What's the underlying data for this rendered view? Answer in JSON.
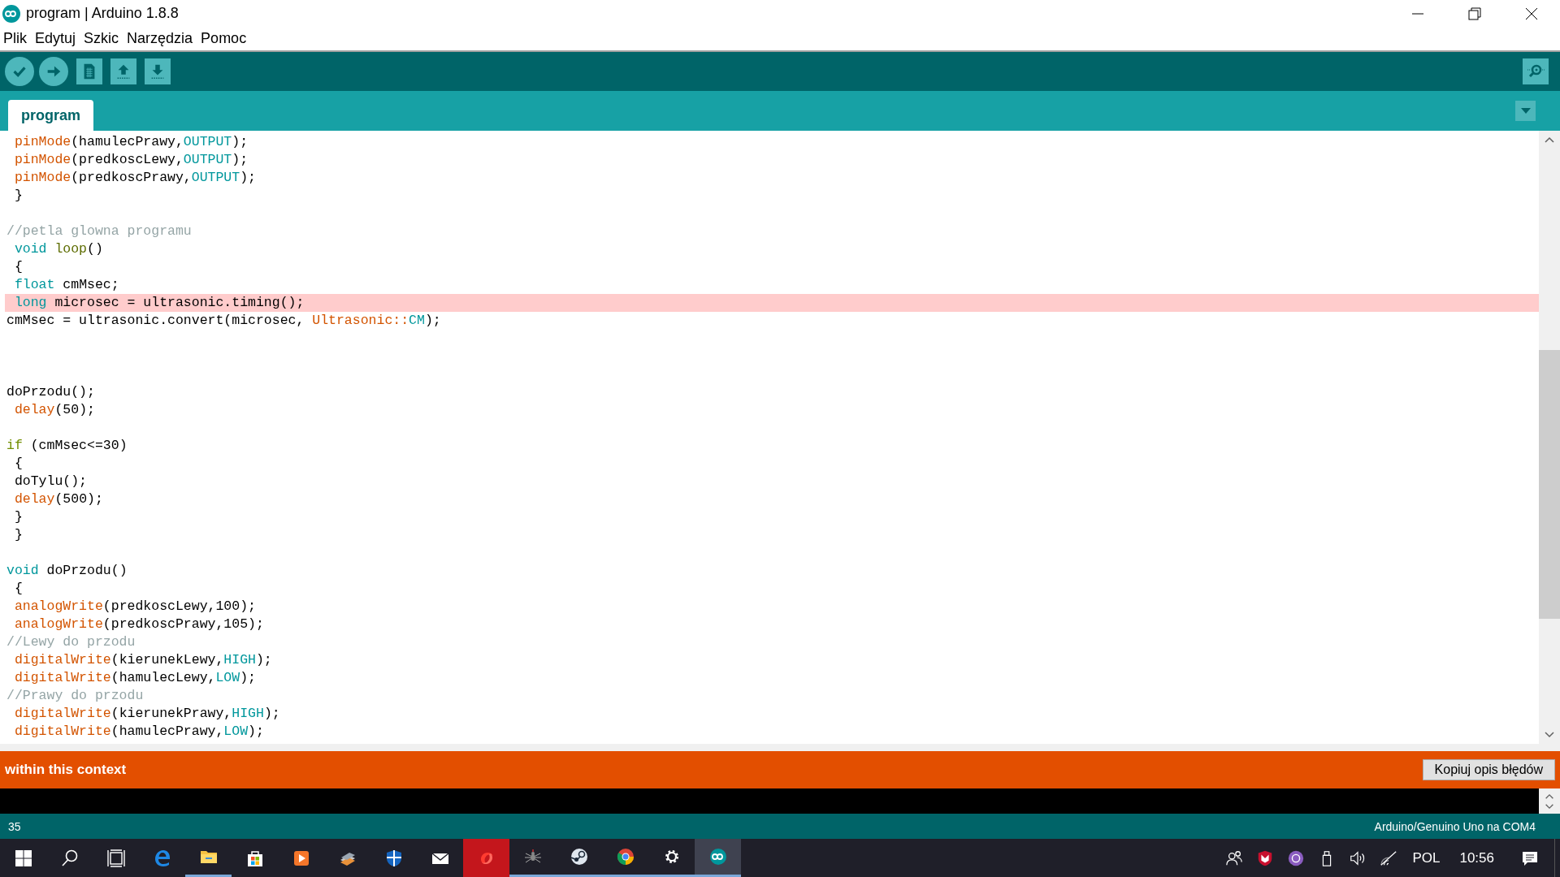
{
  "window": {
    "title": "program | Arduino 1.8.8"
  },
  "menu": [
    "Plik",
    "Edytuj",
    "Szkic",
    "Narzędzia",
    "Pomoc"
  ],
  "toolbar": {
    "buttons": [
      {
        "kind": "verify"
      },
      {
        "kind": "upload"
      },
      {
        "kind": "new"
      },
      {
        "kind": "open"
      },
      {
        "kind": "save"
      }
    ]
  },
  "tabs": [
    {
      "label": "program",
      "selected": true
    }
  ],
  "editor": {
    "lines": [
      {
        "highlighted": false,
        "tokens": [
          {
            "t": " pinMode",
            "kind": "fn"
          },
          {
            "t": "(hamulecPrawy,",
            "kind": "p"
          },
          {
            "t": "OUTPUT",
            "kind": "const"
          },
          {
            "t": ");",
            "kind": "p"
          }
        ]
      },
      {
        "highlighted": false,
        "tokens": [
          {
            "t": " pinMode",
            "kind": "fn"
          },
          {
            "t": "(predkoscLewy,",
            "kind": "p"
          },
          {
            "t": "OUTPUT",
            "kind": "const"
          },
          {
            "t": ");",
            "kind": "p"
          }
        ]
      },
      {
        "highlighted": false,
        "tokens": [
          {
            "t": " pinMode",
            "kind": "fn"
          },
          {
            "t": "(predkoscPrawy,",
            "kind": "p"
          },
          {
            "t": "OUTPUT",
            "kind": "const"
          },
          {
            "t": ");",
            "kind": "p"
          }
        ]
      },
      {
        "highlighted": false,
        "tokens": [
          {
            "t": " }",
            "kind": "p"
          }
        ]
      },
      {
        "highlighted": false
      },
      {
        "highlighted": false,
        "tokens": [
          {
            "t": "//petla glowna programu",
            "kind": "cm"
          }
        ]
      },
      {
        "highlighted": false,
        "tokens": [
          {
            "t": " void",
            "kind": "kw"
          },
          {
            "t": " loop",
            "kind": "lp"
          },
          {
            "t": "()",
            "kind": "p"
          }
        ]
      },
      {
        "highlighted": false,
        "tokens": [
          {
            "t": " {",
            "kind": "p"
          }
        ]
      },
      {
        "highlighted": false,
        "tokens": [
          {
            "t": " float",
            "kind": "kw"
          },
          {
            "t": " cmMsec;",
            "kind": "p"
          }
        ]
      },
      {
        "highlighted": true,
        "tokens": [
          {
            "t": " long",
            "kind": "kw"
          },
          {
            "t": " microsec = ultrasonic.timing();",
            "kind": "p"
          }
        ]
      },
      {
        "highlighted": false,
        "tokens": [
          {
            "t": "cmMsec = ultrasonic.convert(microsec, ",
            "kind": "p"
          },
          {
            "t": "Ultrasonic::",
            "kind": "fn"
          },
          {
            "t": "CM",
            "kind": "const"
          },
          {
            "t": ");",
            "kind": "p"
          }
        ]
      },
      {
        "highlighted": false
      },
      {
        "highlighted": false
      },
      {
        "highlighted": false
      },
      {
        "highlighted": false,
        "tokens": [
          {
            "t": "doPrzodu();",
            "kind": "p"
          }
        ]
      },
      {
        "highlighted": false,
        "tokens": [
          {
            "t": " delay",
            "kind": "fn"
          },
          {
            "t": "(50);",
            "kind": "p"
          }
        ]
      },
      {
        "highlighted": false
      },
      {
        "highlighted": false,
        "tokens": [
          {
            "t": "if",
            "kind": "st"
          },
          {
            "t": " (cmMsec<=30)",
            "kind": "p"
          }
        ]
      },
      {
        "highlighted": false,
        "tokens": [
          {
            "t": " {",
            "kind": "p"
          }
        ]
      },
      {
        "highlighted": false,
        "tokens": [
          {
            "t": " doTylu();",
            "kind": "p"
          }
        ]
      },
      {
        "highlighted": false,
        "tokens": [
          {
            "t": " delay",
            "kind": "fn"
          },
          {
            "t": "(500);",
            "kind": "p"
          }
        ]
      },
      {
        "highlighted": false,
        "tokens": [
          {
            "t": " }",
            "kind": "p"
          }
        ]
      },
      {
        "highlighted": false,
        "tokens": [
          {
            "t": " }",
            "kind": "p"
          }
        ]
      },
      {
        "highlighted": false
      },
      {
        "highlighted": false,
        "tokens": [
          {
            "t": "void",
            "kind": "kw"
          },
          {
            "t": " doPrzodu()",
            "kind": "p"
          }
        ]
      },
      {
        "highlighted": false,
        "tokens": [
          {
            "t": " {",
            "kind": "p"
          }
        ]
      },
      {
        "highlighted": false,
        "tokens": [
          {
            "t": " analogWrite",
            "kind": "fn"
          },
          {
            "t": "(predkoscLewy,100);",
            "kind": "p"
          }
        ]
      },
      {
        "highlighted": false,
        "tokens": [
          {
            "t": " analogWrite",
            "kind": "fn"
          },
          {
            "t": "(predkoscPrawy,105);",
            "kind": "p"
          }
        ]
      },
      {
        "highlighted": false,
        "tokens": [
          {
            "t": "//Lewy do przodu",
            "kind": "cm"
          }
        ]
      },
      {
        "highlighted": false,
        "tokens": [
          {
            "t": " digitalWrite",
            "kind": "fn"
          },
          {
            "t": "(kierunekLewy,",
            "kind": "p"
          },
          {
            "t": "HIGH",
            "kind": "const"
          },
          {
            "t": ");",
            "kind": "p"
          }
        ]
      },
      {
        "highlighted": false,
        "tokens": [
          {
            "t": " digitalWrite",
            "kind": "fn"
          },
          {
            "t": "(hamulecLewy,",
            "kind": "p"
          },
          {
            "t": "LOW",
            "kind": "const"
          },
          {
            "t": ");",
            "kind": "p"
          }
        ]
      },
      {
        "highlighted": false,
        "tokens": [
          {
            "t": "//Prawy do przodu",
            "kind": "cm"
          }
        ]
      },
      {
        "highlighted": false,
        "tokens": [
          {
            "t": " digitalWrite",
            "kind": "fn"
          },
          {
            "t": "(kierunekPrawy,",
            "kind": "p"
          },
          {
            "t": "HIGH",
            "kind": "const"
          },
          {
            "t": ");",
            "kind": "p"
          }
        ]
      },
      {
        "highlighted": false,
        "tokens": [
          {
            "t": " digitalWrite",
            "kind": "fn"
          },
          {
            "t": "(hamulecPrawy,",
            "kind": "p"
          },
          {
            "t": "LOW",
            "kind": "const"
          },
          {
            "t": ");",
            "kind": "p"
          }
        ]
      }
    ]
  },
  "message_bar": {
    "text": "within this context",
    "button": "Kopiuj opis błędów"
  },
  "status_bar": {
    "line": "35",
    "board": "Arduino/Genuino Uno na COM4"
  },
  "taskbar": {
    "buttons": [
      {
        "kind": "start",
        "running": false,
        "flashing": false,
        "selected": false
      },
      {
        "kind": "search",
        "running": false,
        "flashing": false,
        "selected": false
      },
      {
        "kind": "taskview",
        "running": false,
        "flashing": false,
        "selected": false
      },
      {
        "kind": "edge",
        "running": false,
        "flashing": false,
        "selected": false
      },
      {
        "kind": "folder",
        "running": true,
        "flashing": false,
        "selected": false
      },
      {
        "kind": "store",
        "running": false,
        "flashing": false,
        "selected": false
      },
      {
        "kind": "media",
        "running": false,
        "flashing": false,
        "selected": false
      },
      {
        "kind": "books",
        "running": false,
        "flashing": false,
        "selected": false
      },
      {
        "kind": "shield",
        "running": false,
        "flashing": false,
        "selected": false
      },
      {
        "kind": "mail",
        "running": false,
        "flashing": false,
        "selected": false
      },
      {
        "kind": "ring",
        "running": false,
        "flashing": true,
        "selected": false
      },
      {
        "kind": "spider",
        "running": true,
        "flashing": false,
        "selected": false
      },
      {
        "kind": "steam",
        "running": true,
        "flashing": false,
        "selected": false
      },
      {
        "kind": "chrome",
        "running": true,
        "flashing": false,
        "selected": false
      },
      {
        "kind": "gear",
        "running": true,
        "flashing": false,
        "selected": false
      },
      {
        "kind": "arduino",
        "running": true,
        "flashing": false,
        "selected": true
      }
    ],
    "tray": [
      {
        "kind": "people"
      },
      {
        "kind": "antivirus"
      },
      {
        "kind": "gog"
      },
      {
        "kind": "usb"
      },
      {
        "kind": "volume"
      },
      {
        "kind": "wifi"
      }
    ],
    "language": "POL",
    "time": "10:56"
  }
}
